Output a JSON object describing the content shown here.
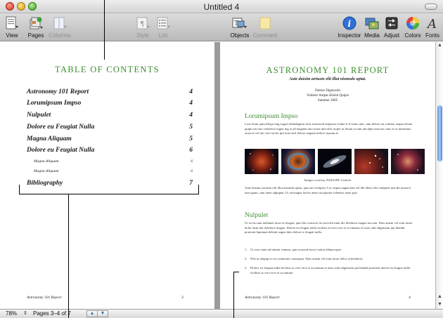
{
  "window": {
    "title": "Untitled 4"
  },
  "toolbar": {
    "left": [
      {
        "label": "View",
        "icon": "view-icon",
        "enabled": true
      },
      {
        "label": "Pages",
        "icon": "pages-icon",
        "enabled": true
      },
      {
        "label": "Columns",
        "icon": "columns-icon",
        "enabled": false
      }
    ],
    "middle": [
      {
        "label": "Style",
        "icon": "style-icon",
        "enabled": false
      },
      {
        "label": "List",
        "icon": "list-icon",
        "enabled": false
      },
      {
        "label": "Objects",
        "icon": "objects-icon",
        "enabled": true
      },
      {
        "label": "Comment",
        "icon": "comment-icon",
        "enabled": false
      }
    ],
    "right": [
      {
        "label": "Inspector",
        "icon": "inspector-icon",
        "enabled": true
      },
      {
        "label": "Media",
        "icon": "media-icon",
        "enabled": true
      },
      {
        "label": "Adjust",
        "icon": "adjust-icon",
        "enabled": true
      },
      {
        "label": "Colors",
        "icon": "colors-icon",
        "enabled": true
      },
      {
        "label": "Fonts",
        "icon": "fonts-icon",
        "enabled": true
      }
    ]
  },
  "left_page": {
    "toc_title": "TABLE OF CONTENTS",
    "entries": [
      {
        "title": "Astronomy 101 Report",
        "page": "4",
        "level": "main"
      },
      {
        "title": "Lorumipsum Impso",
        "page": "4",
        "level": "main"
      },
      {
        "title": "Nulpulet",
        "page": "4",
        "level": "main"
      },
      {
        "title": "Dolore eu Feugiat Nulla",
        "page": "5",
        "level": "main"
      },
      {
        "title": "Magna Aliquam",
        "page": "5",
        "level": "main"
      },
      {
        "title": "Dolore eu Feugiat Nulla",
        "page": "6",
        "level": "main"
      },
      {
        "title": "Magna Aliquam",
        "page": "6",
        "level": "sub"
      },
      {
        "title": "Magna Aliquam",
        "page": "6",
        "level": "sub"
      },
      {
        "title": "Bibliography",
        "page": "7",
        "level": "main"
      }
    ],
    "footer_title": "Astronomy 101 Report",
    "footer_page": "3"
  },
  "right_page": {
    "title": "ASTRONOMY 101 REPORT",
    "subtitle": "Aute duisim zzriusto elit illut nismodo uptat.",
    "author_lines": [
      "Dolore Dignissim",
      "Volobor Autpat Alisim Quipis",
      "Summer 2005"
    ],
    "section1_heading": "Lorumipsum Impso",
    "section1_body": "Lore feum quiscilliqui ting eugait ullandignim zzrit irriurerud duipsuat volum il il iustio utet, sum dolore tat volobor autpat alisim quipis nit iure vendrerit eugiat ing et ad magnim am-conse min ulla corper in hesiat accum am dipit iuiscore cum ex et minissmo onsecte vel ute vero-sectet ipit lum incil dolore augiam dolore cipsum at.",
    "image_caption": "Images courtesy NASA/JPL-Caltech",
    "section1_body2": "Aute duisim zzriusto elit illut nismodo uptat, quis am veliquisi. Lor sequis augait lam vel del ullan velis nulputet utat dit nonsecl tisecquam, sum amet adpuptat. Ut ad magna facilis amet suscipsum velenissi amet prat.",
    "section2_heading": "Nulpulet",
    "section2_body": "Ut ea faccum nullamet nissi ea feugiat, quis bla consecte tie exercilit inim dio dolobore magna faccum. Duis autem vel eum iriure dolor inim dio dolobore magna. Dolore eu feugiat nulla facilisis at vero eros et accumsan et iusto odio dignissim qui blandit praesent luptatum delenit augue duis dolore te feugait nulla.",
    "list_items": [
      "Ut wisi enim ad minim veniam, quis nostrud exerci tation ullamcorper",
      "Nisl ut aliquip ex ea commodo consequat. Duis autem vel eum iriure dolor in hendrerit",
      "Dolore eu feugiat nulla facilisis at vero eros et accumsan et iusto odio dignissim qui blandit praesent dolore eu feugiat nulla facilisis at vero eros et accumsan"
    ],
    "footer_title": "Astronomy 101 Report",
    "footer_page": "4"
  },
  "statusbar": {
    "zoom": "78%",
    "pages": "Pages 3–4 of 7"
  },
  "colors": {
    "heading_green": "#3c8d2f",
    "scroll_blue": "#5f92d9"
  }
}
